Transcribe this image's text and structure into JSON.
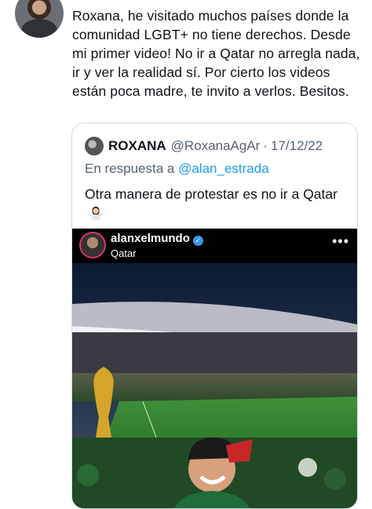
{
  "tweet": {
    "text": "Roxana, he visitado muchos países donde la comunidad LGBT+ no tiene derechos. Desde mi primer video! No ir a Qatar no arregla nada, ir y ver la realidad sí. Por cierto los videos están poca madre, te invito a verlos. Besitos."
  },
  "quote": {
    "name": "ROXANA",
    "handle": "@RoxanaAgAr",
    "separator": "·",
    "date": "17/12/22",
    "reply_prefix": "En respuesta a",
    "reply_to": "@alan_estrada",
    "text": "Otra manera de protestar es no ir a Qatar"
  },
  "instagram": {
    "username": "alanxelmundo",
    "location": "Qatar",
    "more": "•••",
    "verified_mark": "✓"
  },
  "icons": {
    "avatar": "user-avatar",
    "quote_avatar": "quoted-user-avatar",
    "verified": "verified-badge-icon",
    "emoji": "woman-tipping-hand-emoji",
    "more": "more-options-icon"
  }
}
